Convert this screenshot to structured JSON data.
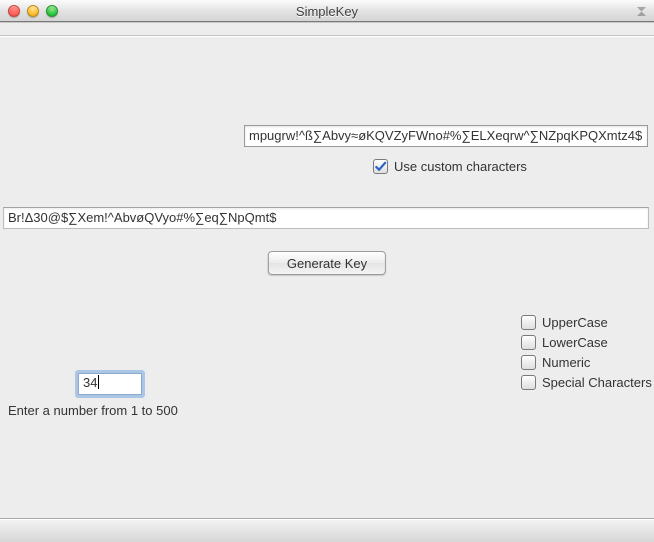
{
  "window": {
    "title": "SimpleKey"
  },
  "custom_chars": {
    "value": "mpugrw!^ß∑Abvy≈øKQVZyFWno#%∑ELXeqrw^∑NZpqKPQXmtz4$"
  },
  "use_custom": {
    "label": "Use custom characters",
    "checked": true
  },
  "output": {
    "value": "Br!Δ30@$∑Xem!^AbvøQVyo#%∑eq∑NpQmt$"
  },
  "generate": {
    "label": "Generate Key"
  },
  "options": [
    {
      "label": "UpperCase",
      "checked": false
    },
    {
      "label": "LowerCase",
      "checked": false
    },
    {
      "label": "Numeric",
      "checked": false
    },
    {
      "label": "Special Characters",
      "checked": false
    }
  ],
  "length": {
    "value": "34",
    "hint": "Enter a number from 1 to 500"
  }
}
